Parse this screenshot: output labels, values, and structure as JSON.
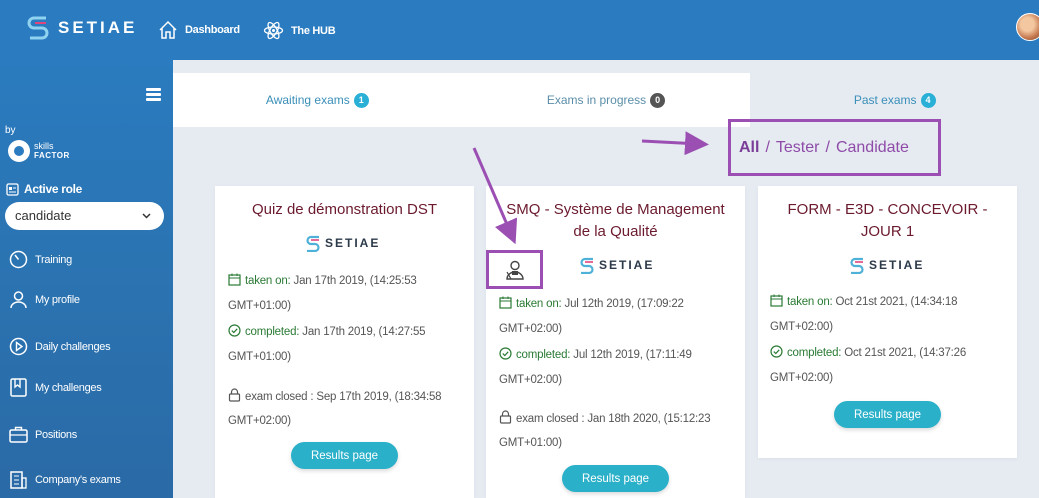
{
  "header": {
    "brand": "SETIAE",
    "nav": [
      {
        "label": "Dashboard",
        "icon": "home-icon"
      },
      {
        "label": "The HUB",
        "icon": "atom-icon"
      }
    ]
  },
  "sidebar": {
    "by_label": "by",
    "partner": {
      "line1": "skills",
      "line2": "FACTOR"
    },
    "active_role_title": "Active role",
    "role_value": "candidate",
    "items": [
      {
        "label": "Training",
        "icon": "gauge-icon"
      },
      {
        "label": "My profile",
        "icon": "user-icon"
      },
      {
        "label": "Daily challenges",
        "icon": "play-icon"
      },
      {
        "label": "My challenges",
        "icon": "bookmark-icon"
      },
      {
        "label": "Positions",
        "icon": "briefcase-icon"
      },
      {
        "label": "Company's exams",
        "icon": "building-icon"
      }
    ]
  },
  "tabs": [
    {
      "label": "Awaiting exams",
      "badge": "1",
      "badge_color": "#2ab0d6"
    },
    {
      "label": "Exams in progress",
      "badge": "0",
      "badge_color": "#555555"
    },
    {
      "label": "Past exams",
      "badge": "4",
      "badge_color": "#2ab0d6",
      "active": true
    }
  ],
  "filter": {
    "all": "All",
    "sep": "/",
    "tester": "Tester",
    "candidate": "Candidate"
  },
  "colors": {
    "accent": "#2a7bbf",
    "highlight": "#9b4fb3",
    "button": "#2ab0c9",
    "title": "#6b1a2e",
    "label_green": "#2a7a34"
  },
  "cards": [
    {
      "title": "Quiz de démonstration DST",
      "logo": "SETIAE",
      "taken_label": "taken on:",
      "taken_value": "Jan 17th 2019, (14:25:53",
      "taken_tz": "GMT+01:00)",
      "completed_label": "completed:",
      "completed_value": "Jan 17th 2019, (14:27:55",
      "completed_tz": "GMT+01:00)",
      "closed_label": "exam closed :",
      "closed_value": "Sep 17th 2019, (18:34:58",
      "closed_tz": "GMT+02:00)",
      "button": "Results page"
    },
    {
      "title_line1": "SMQ - Système de Management",
      "title_line2": "de la Qualité",
      "logo": "SETIAE",
      "taken_label": "taken on:",
      "taken_value": "Jul 12th 2019, (17:09:22",
      "taken_tz": "GMT+02:00)",
      "completed_label": "completed:",
      "completed_value": "Jul 12th 2019, (17:11:49",
      "completed_tz": "GMT+02:00)",
      "closed_label": "exam closed :",
      "closed_value": "Jan 18th 2020, (15:12:23",
      "closed_tz": "GMT+01:00)",
      "button": "Results page"
    },
    {
      "title_line1": "FORM - E3D - CONCEVOIR -",
      "title_line2": "JOUR 1",
      "logo": "SETIAE",
      "taken_label": "taken on:",
      "taken_value": "Oct 21st 2021, (14:34:18",
      "taken_tz": "GMT+02:00)",
      "completed_label": "completed:",
      "completed_value": "Oct 21st 2021, (14:37:26",
      "completed_tz": "GMT+02:00)",
      "button": "Results page"
    }
  ]
}
